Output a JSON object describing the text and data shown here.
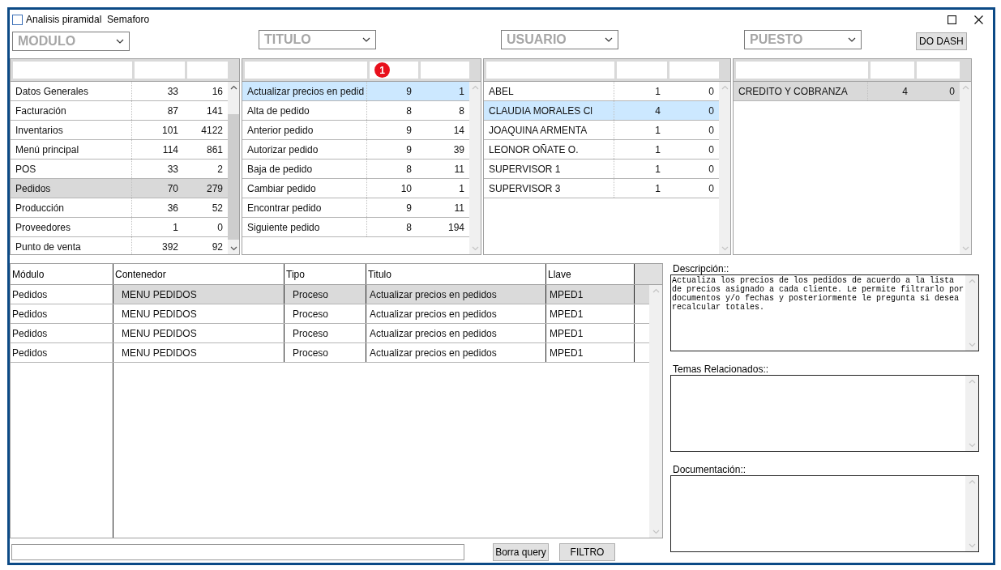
{
  "window": {
    "title": "Analisis piramidal  Semaforo"
  },
  "filters": [
    {
      "label": "MODULO"
    },
    {
      "label": "TITULO"
    },
    {
      "label": "USUARIO"
    },
    {
      "label": "PUESTO"
    }
  ],
  "dash_button": "DO DASH",
  "grids": [
    {
      "focused": false,
      "scroll_thumb": true,
      "rows": [
        {
          "name": "Datos Generales",
          "count_1": "33",
          "count_2": "16",
          "selected": false
        },
        {
          "name": "Facturación",
          "count_1": "87",
          "count_2": "141",
          "selected": false
        },
        {
          "name": "Inventarios",
          "count_1": "101",
          "count_2": "4122",
          "selected": false
        },
        {
          "name": "Menú principal",
          "count_1": "114",
          "count_2": "861",
          "selected": false
        },
        {
          "name": "POS",
          "count_1": "33",
          "count_2": "2",
          "selected": false
        },
        {
          "name": "Pedidos",
          "count_1": "70",
          "count_2": "279",
          "selected": true
        },
        {
          "name": "Producción",
          "count_1": "36",
          "count_2": "52",
          "selected": false
        },
        {
          "name": "Proveedores",
          "count_1": "1",
          "count_2": "0",
          "selected": false
        },
        {
          "name": "Punto de venta",
          "count_1": "392",
          "count_2": "92",
          "selected": false
        }
      ]
    },
    {
      "focused": true,
      "scroll_thumb": false,
      "badge": "1",
      "rows": [
        {
          "name": "Actualizar precios en pedid",
          "count_1": "9",
          "count_2": "1",
          "selected": true
        },
        {
          "name": "Alta de pedido",
          "count_1": "8",
          "count_2": "8",
          "selected": false
        },
        {
          "name": "Anterior pedido",
          "count_1": "9",
          "count_2": "14",
          "selected": false
        },
        {
          "name": "Autorizar pedido",
          "count_1": "9",
          "count_2": "39",
          "selected": false
        },
        {
          "name": "Baja de pedido",
          "count_1": "8",
          "count_2": "11",
          "selected": false
        },
        {
          "name": "Cambiar pedido",
          "count_1": "10",
          "count_2": "1",
          "selected": false
        },
        {
          "name": "Encontrar pedido",
          "count_1": "9",
          "count_2": "11",
          "selected": false
        },
        {
          "name": "Siguiente pedido",
          "count_1": "8",
          "count_2": "194",
          "selected": false
        }
      ]
    },
    {
      "focused": true,
      "scroll_thumb": false,
      "rows": [
        {
          "name": "ABEL",
          "count_1": "1",
          "count_2": "0",
          "selected": false
        },
        {
          "name": "CLAUDIA MORALES Cl",
          "count_1": "4",
          "count_2": "0",
          "selected": true
        },
        {
          "name": "JOAQUINA ARMENTA",
          "count_1": "1",
          "count_2": "0",
          "selected": false
        },
        {
          "name": "LEONOR OÑATE O.",
          "count_1": "1",
          "count_2": "0",
          "selected": false
        },
        {
          "name": "SUPERVISOR 1",
          "count_1": "1",
          "count_2": "0",
          "selected": false
        },
        {
          "name": "SUPERVISOR 3",
          "count_1": "1",
          "count_2": "0",
          "selected": false
        }
      ]
    },
    {
      "focused": false,
      "scroll_thumb": false,
      "rows": [
        {
          "name": "CREDITO Y COBRANZA",
          "count_1": "4",
          "count_2": "0",
          "selected": true
        }
      ]
    }
  ],
  "results": {
    "columns": [
      "Módulo",
      "Contenedor",
      "Tipo",
      "Titulo",
      "Llave"
    ],
    "rows": [
      {
        "cells": [
          "Pedidos",
          "MENU PEDIDOS",
          "Proceso",
          "Actualizar precios en pedidos",
          "MPED1"
        ],
        "selected": true
      },
      {
        "cells": [
          "Pedidos",
          "MENU PEDIDOS",
          "Proceso",
          "Actualizar precios en pedidos",
          "MPED1"
        ],
        "selected": false
      },
      {
        "cells": [
          "Pedidos",
          "MENU PEDIDOS",
          "Proceso",
          "Actualizar precios en pedidos",
          "MPED1"
        ],
        "selected": false
      },
      {
        "cells": [
          "Pedidos",
          "MENU PEDIDOS",
          "Proceso",
          "Actualizar precios en pedidos",
          "MPED1"
        ],
        "selected": false
      }
    ]
  },
  "buttons": [
    "Borra query",
    "FILTRO"
  ],
  "panels": [
    {
      "label": "Descripción::",
      "value": "Actualiza los precios de los pedidos de acuerdo a la lista de precios asignado a cada cliente. Le permite filtrarlo por documentos y/o fechas y posteriormente le pregunta si desea recalcular totales."
    },
    {
      "label": "Temas Relacionados::"
    },
    {
      "label": "Documentación::"
    }
  ]
}
